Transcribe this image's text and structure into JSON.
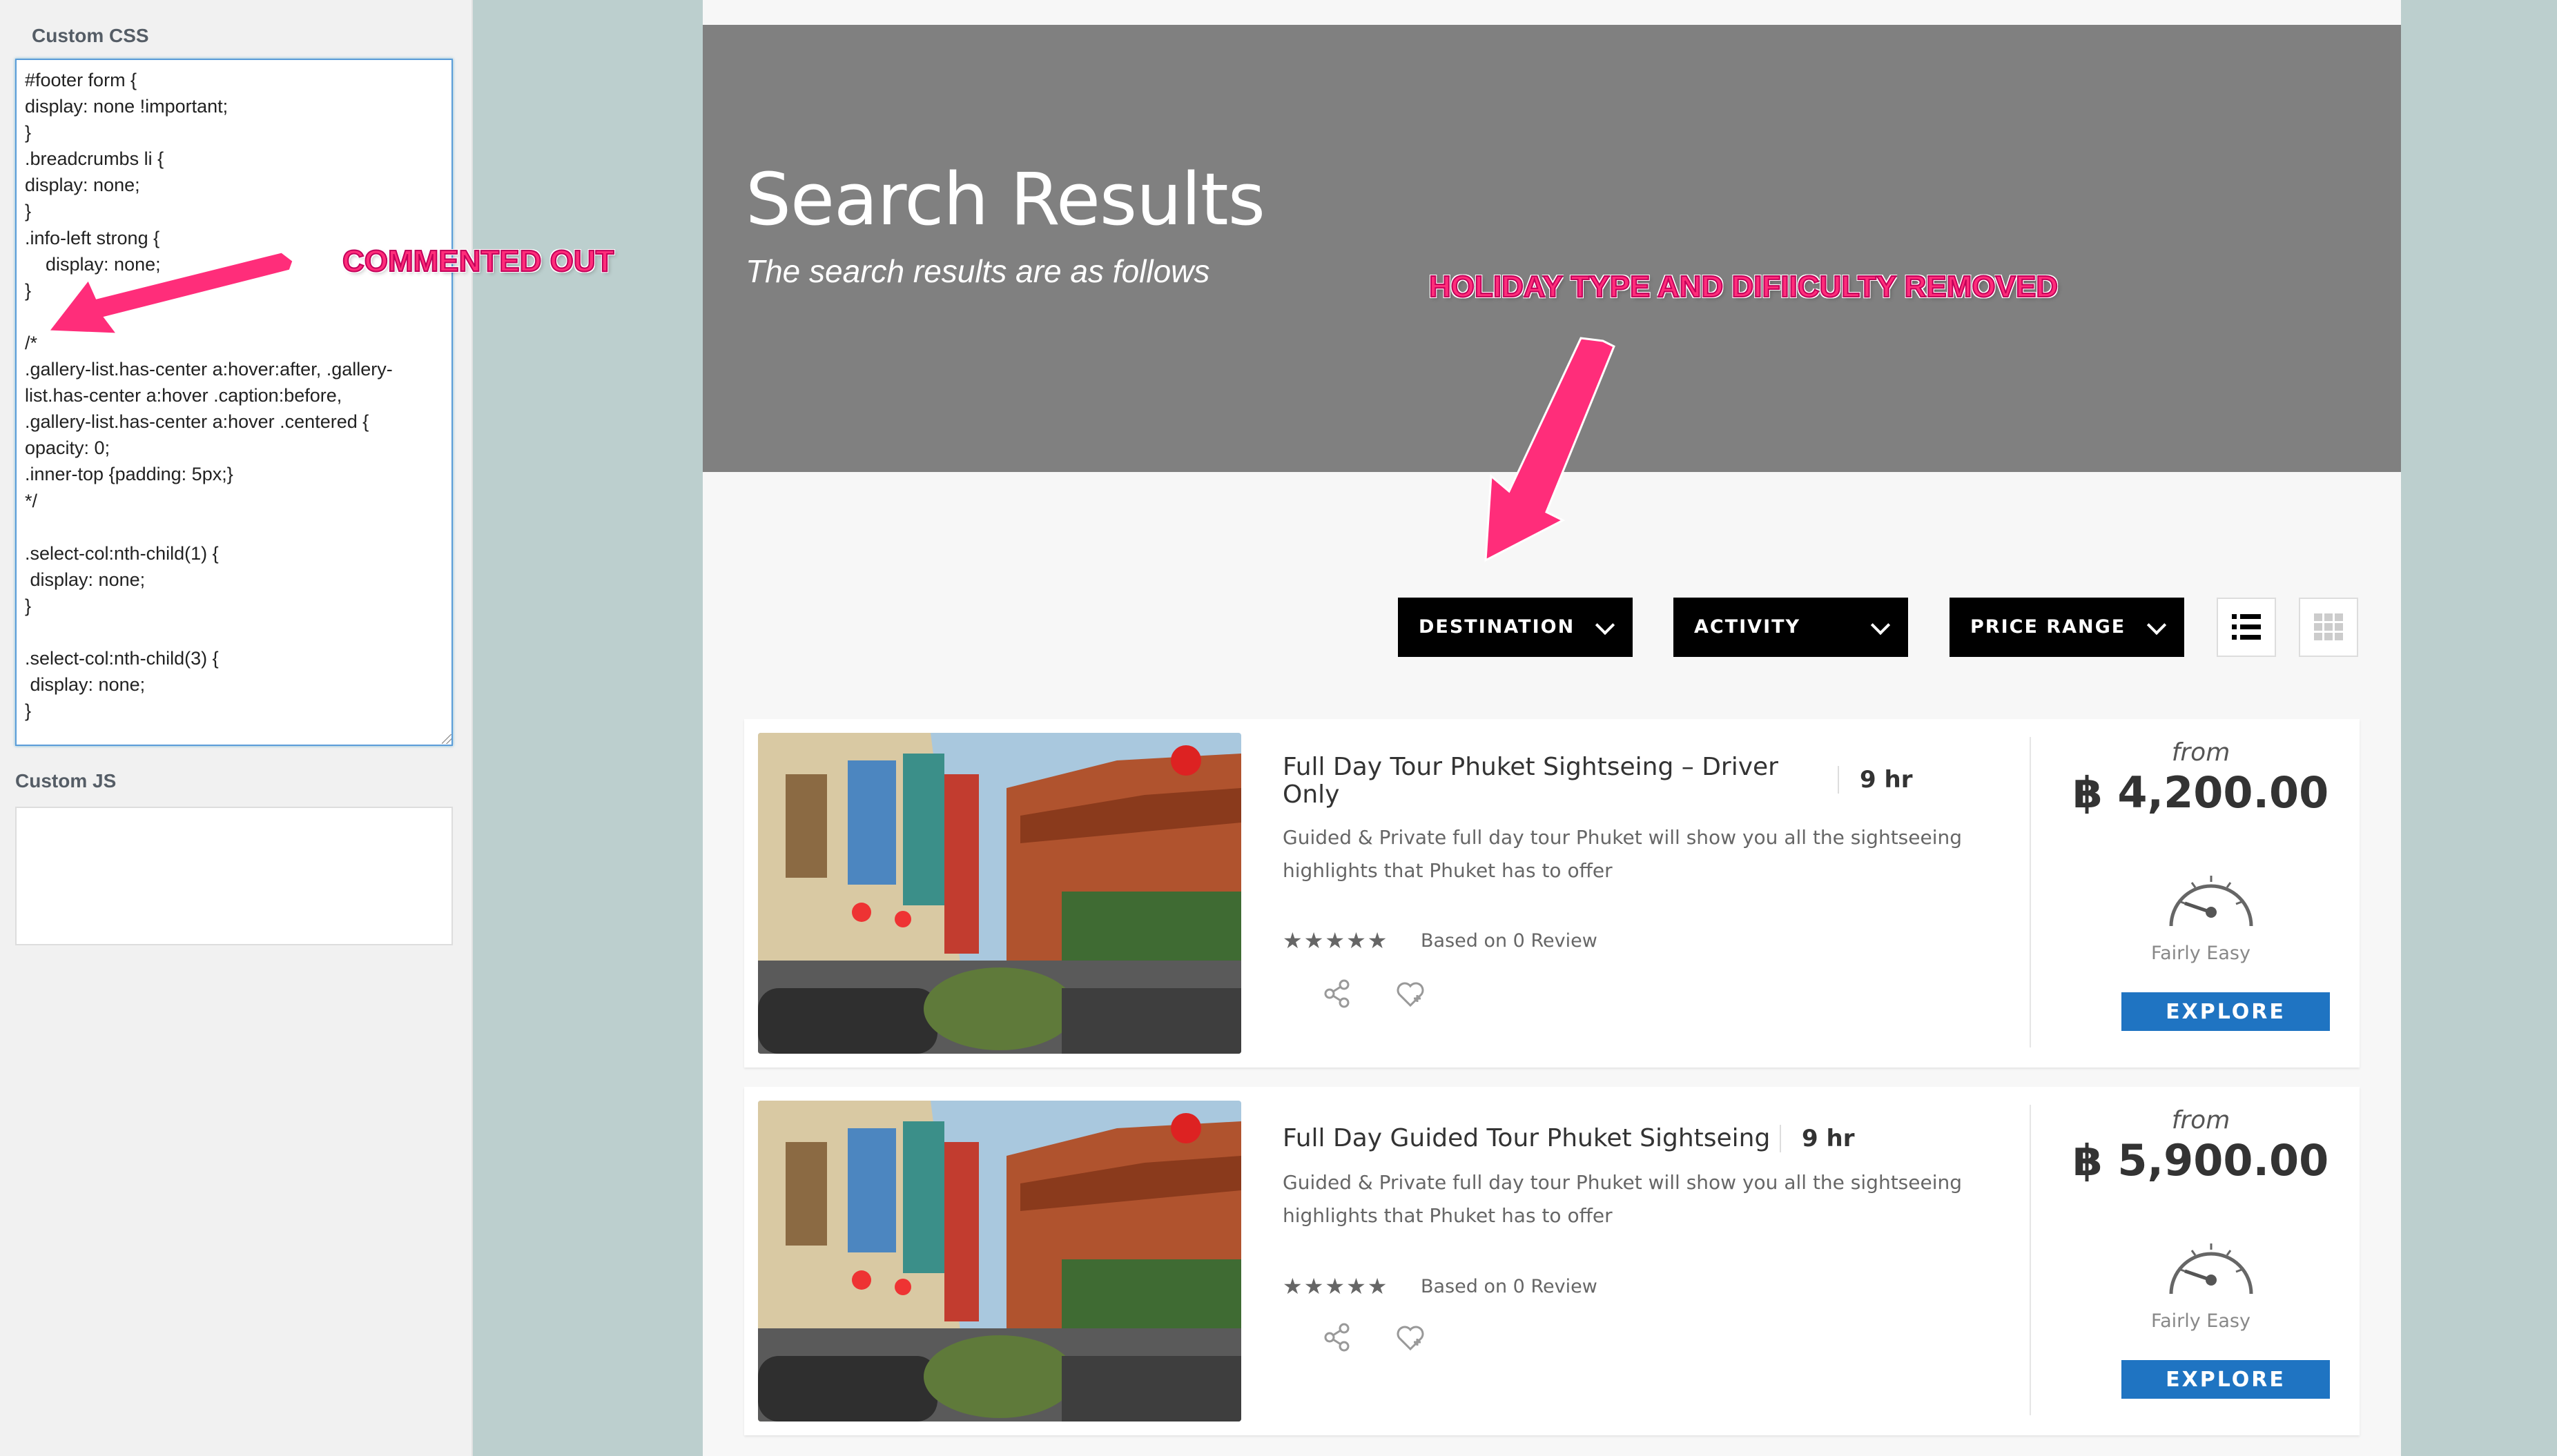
{
  "admin": {
    "custom_css_label": "Custom CSS",
    "custom_css_code": "#footer form {\ndisplay: none !important;\n}\n.breadcrumbs li {\ndisplay: none;\n}\n.info-left strong {\n    display: none;\n}\n\n/*\n.gallery-list.has-center a:hover:after, .gallery-\nlist.has-center a:hover .caption:before,\n.gallery-list.has-center a:hover .centered {\nopacity: 0;\n.inner-top {padding: 5px;}\n*/\n\n.select-col:nth-child(1) {\n display: none;\n}\n\n.select-col:nth-child(3) {\n display: none;\n}",
    "custom_js_label": "Custom JS",
    "custom_js_code": ""
  },
  "annotations": {
    "commented_out": "COMMENTED OUT",
    "holiday_type": "HOLIDAY TYPE AND DIFIICULTY REMOVED",
    "color": "#ff2d7a"
  },
  "hero": {
    "title": "Search Results",
    "subtitle": "The search results are as follows"
  },
  "filters": {
    "destination": "DESTINATION",
    "activity": "ACTIVITY",
    "price_range": "PRICE RANGE",
    "view_icons": [
      "list-view-icon",
      "grid-view-icon"
    ]
  },
  "results": [
    {
      "title": "Full Day Tour Phuket Sightseing – Driver Only",
      "duration": "9 hr",
      "description": "Guided & Private full day tour Phuket will show you all the sightseeing highlights that Phuket has to offer",
      "stars": "★★★★★",
      "reviews": "Based on 0 Review",
      "price_from": "from",
      "price": "฿ 4,200.00",
      "difficulty": "Fairly Easy",
      "cta": "EXPLORE"
    },
    {
      "title": "Full Day Guided Tour Phuket Sightseing",
      "duration": "9 hr",
      "description": "Guided & Private full day tour Phuket will show you all the sightseeing highlights that Phuket has to offer",
      "stars": "★★★★★",
      "reviews": "Based on 0 Review",
      "price_from": "from",
      "price": "฿ 5,900.00",
      "difficulty": "Fairly Easy",
      "cta": "EXPLORE"
    }
  ],
  "colors": {
    "accent_button": "#1f74c2",
    "hero_bg": "#808080",
    "filter_bg": "#000000"
  }
}
